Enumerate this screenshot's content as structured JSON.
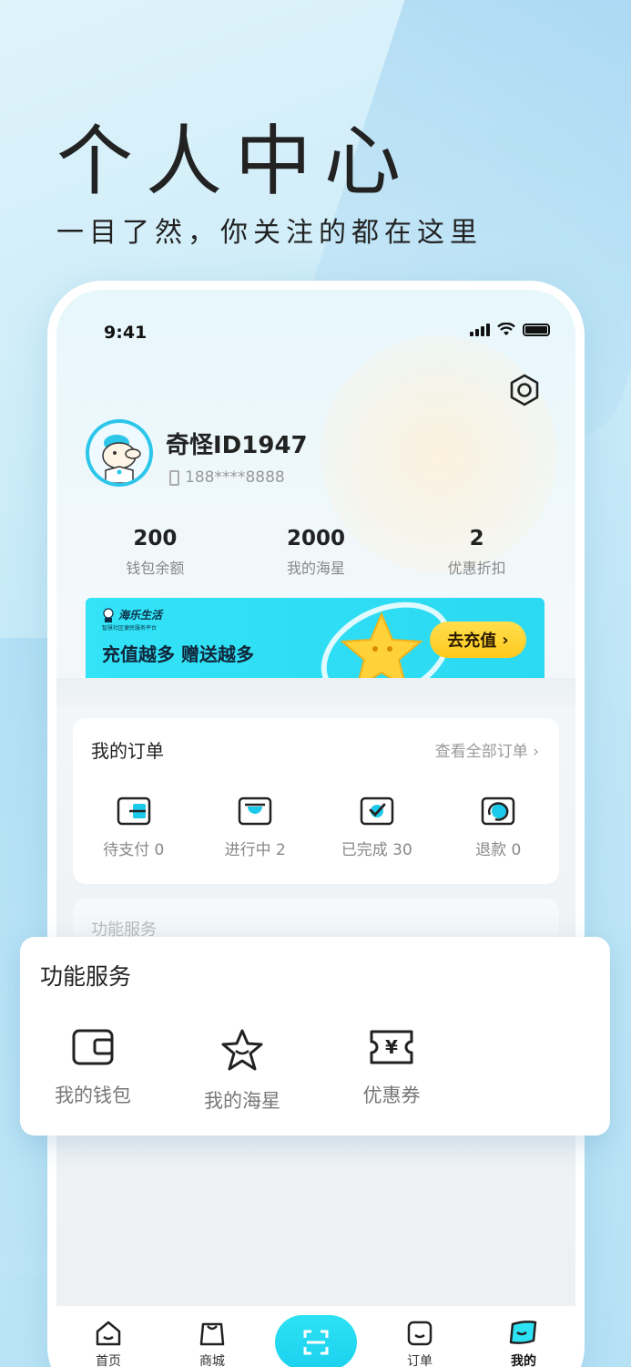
{
  "hero": {
    "title": "个人中心",
    "subtitle": "一目了然，你关注的都在这里"
  },
  "status_bar": {
    "time": "9:41"
  },
  "profile": {
    "name": "奇怪ID1947",
    "phone": "188****8888"
  },
  "stats": [
    {
      "value": "200",
      "label": "钱包余额"
    },
    {
      "value": "2000",
      "label": "我的海星"
    },
    {
      "value": "2",
      "label": "优惠折扣"
    }
  ],
  "banner": {
    "logo": "海乐生活",
    "logo_sub": "智慧社区便民服务平台",
    "text": "充值越多 赠送越多",
    "button": "去充值"
  },
  "orders": {
    "title": "我的订单",
    "view_all": "查看全部订单",
    "items": [
      {
        "label": "待支付 0",
        "icon": "wallet-pay-icon"
      },
      {
        "label": "进行中 2",
        "icon": "in-progress-icon"
      },
      {
        "label": "已完成 30",
        "icon": "completed-icon"
      },
      {
        "label": "退款 0",
        "icon": "refund-icon"
      }
    ]
  },
  "ghost_services": {
    "title": "功能服务"
  },
  "services": {
    "title": "功能服务",
    "items": [
      {
        "label": "我的钱包",
        "icon": "wallet-icon"
      },
      {
        "label": "我的海星",
        "icon": "starfish-icon"
      },
      {
        "label": "优惠券",
        "icon": "coupon-icon"
      }
    ]
  },
  "tabbar": {
    "items": [
      {
        "label": "首页",
        "icon": "home-icon"
      },
      {
        "label": "商城",
        "icon": "shop-icon"
      },
      {
        "label": "",
        "icon": "scan-icon"
      },
      {
        "label": "订单",
        "icon": "order-icon"
      },
      {
        "label": "我的",
        "icon": "profile-icon",
        "active": true
      }
    ]
  },
  "colors": {
    "accent": "#2bd9f2",
    "button_yellow": "#ffc91e"
  }
}
